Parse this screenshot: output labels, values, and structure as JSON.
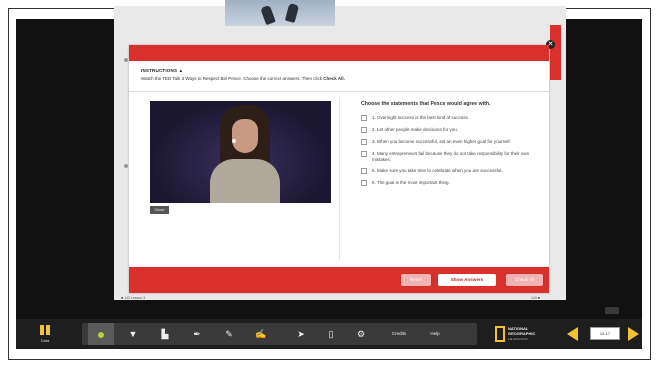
{
  "modal": {
    "instructions_title": "INSTRUCTIONS ▲",
    "instructions_text": "Watch the TED Talk 3 Ways to Respect Bel Pesce. Choose the correct answers. Then click ",
    "instructions_cta": "Check All.",
    "video_button": "Close",
    "question_title": "Choose the statements that Pesce would agree with.",
    "options": [
      "1. Overnight success is the best kind of success.",
      "2. Let other people make decisions for you.",
      "3. When you become successful, set an even higher goal for yourself.",
      "4. Many entrepreneurs fail because they do not take responsibility for their own mistakes.",
      "5. Make sure you take time to celebrate when you are successful.",
      "6. The goal is the most important thing."
    ],
    "buttons": {
      "reset": "Reset",
      "show_answers": "Show Answers",
      "check_all": "Check All"
    }
  },
  "page": {
    "footer_left": "■ 142 Lesson 3",
    "footer_right": "143 ■"
  },
  "toolbar": {
    "data_label": "Data",
    "credits_label": "Credits",
    "help_label": "Help",
    "logo_line1": "NATIONAL",
    "logo_line2": "GEOGRAPHIC",
    "logo_line3": "LEARNING",
    "page_indicator": "14-17"
  },
  "colors": {
    "accent_red": "#d9302c",
    "toolbar_bg": "#1e1e1e",
    "nav_yellow": "#f2c230"
  },
  "icons": [
    "data-icon",
    "dot-icon",
    "marker-icon",
    "stamp-icon",
    "pen-icon",
    "pencil-icon",
    "brush-icon",
    "pointer-icon",
    "page-icon",
    "settings-icon",
    "close-icon"
  ]
}
